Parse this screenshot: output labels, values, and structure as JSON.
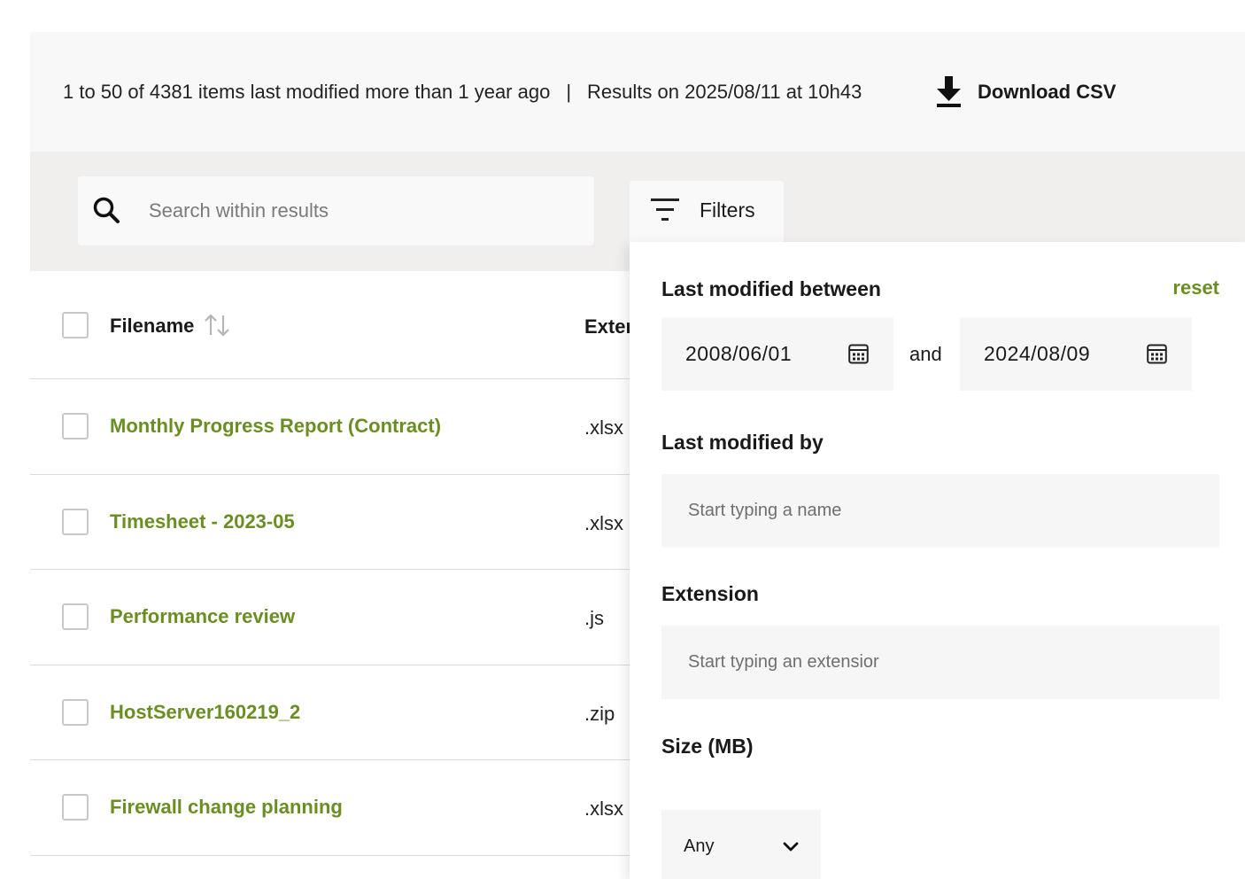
{
  "summary": {
    "range_text": "1 to 50 of 4381 items last modified more than 1 year ago",
    "separator": "|",
    "results_text": "Results on 2025/08/11 at 10h43",
    "download_label": "Download CSV",
    "download_icon": "download-icon"
  },
  "search": {
    "placeholder": "Search within results",
    "value": "",
    "icon": "search-icon"
  },
  "filters_tab": {
    "label": "Filters",
    "icon": "filter-icon"
  },
  "table": {
    "columns": {
      "filename": "Filename",
      "extension": "Exter"
    },
    "rows": [
      {
        "filename": "Monthly Progress Report (Contract)",
        "extension": ".xlsx"
      },
      {
        "filename": "Timesheet - 2023-05",
        "extension": ".xlsx"
      },
      {
        "filename": "Performance review",
        "extension": ".js"
      },
      {
        "filename": "HostServer160219_2",
        "extension": ".zip"
      },
      {
        "filename": "Firewall change planning",
        "extension": ".xlsx"
      }
    ]
  },
  "filter_panel": {
    "last_modified": {
      "title": "Last modified between",
      "reset_label": "reset",
      "from": "2008/06/01",
      "and_label": "and",
      "to": "2024/08/09"
    },
    "modified_by": {
      "title": "Last modified by",
      "placeholder": "Start typing a name"
    },
    "extension": {
      "title": "Extension",
      "placeholder": "Start typing an extensior"
    },
    "size": {
      "title": "Size (MB)",
      "selected": "Any"
    }
  },
  "colors": {
    "accent_green": "#6b8e23",
    "summary_bg": "#f8f8f8",
    "toolbar_bg": "#f1eeee",
    "field_bg": "#f6f6f6"
  }
}
